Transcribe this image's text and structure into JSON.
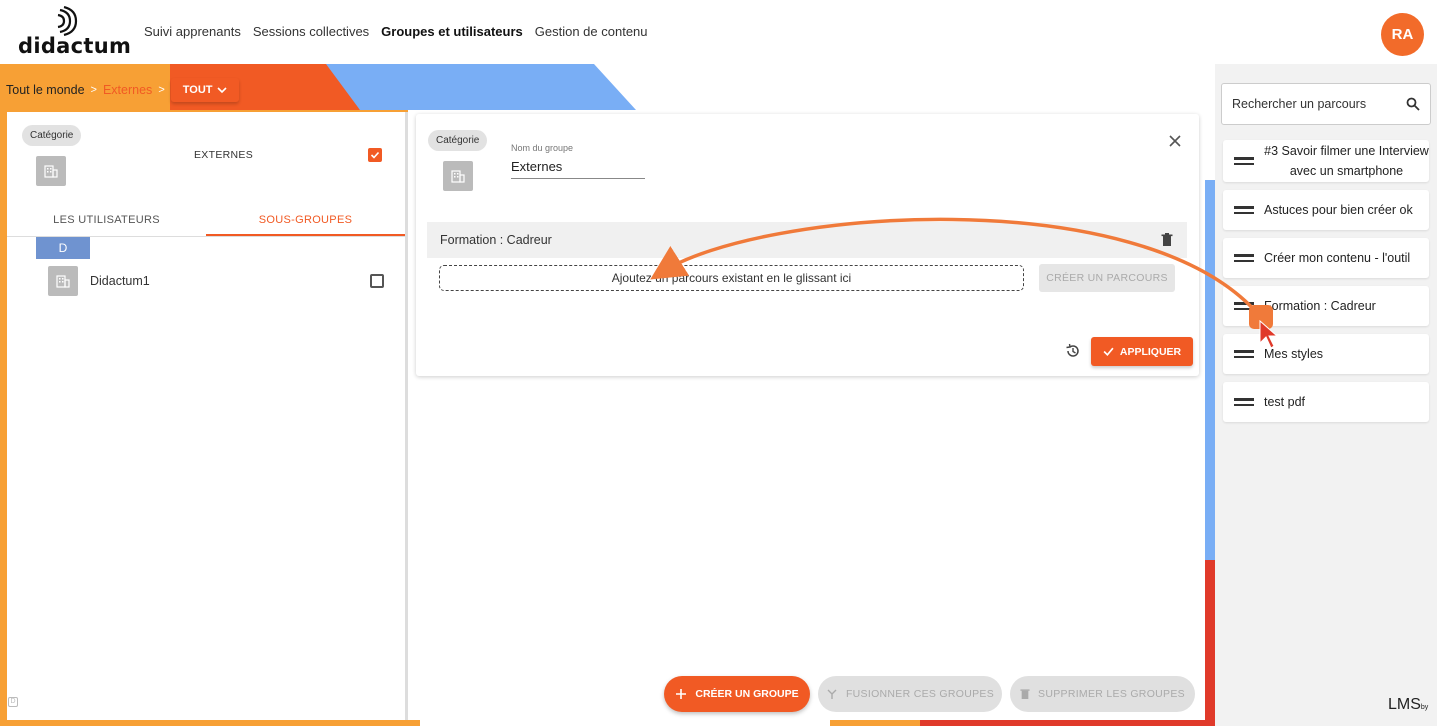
{
  "app": {
    "logo_text": "didactum",
    "avatar_initials": "RA",
    "footer_brand": "LMS",
    "footer_brand_suffix": "by"
  },
  "nav": {
    "items": [
      {
        "label": "Suivi apprenants",
        "active": false
      },
      {
        "label": "Sessions collectives",
        "active": false
      },
      {
        "label": "Groupes et utilisateurs",
        "active": true
      },
      {
        "label": "Gestion de contenu",
        "active": false
      }
    ]
  },
  "breadcrumb": {
    "root": "Tout le monde",
    "separator": ">",
    "current": "Externes",
    "filter_button": "TOUT"
  },
  "left_panel": {
    "chip": "Catégorie",
    "group_name": "EXTERNES",
    "group_checked": true,
    "tabs": [
      {
        "label": "LES UTILISATEURS",
        "active": false
      },
      {
        "label": "SOUS-GROUPES",
        "active": true
      }
    ],
    "letter_header": "D",
    "subgroups": [
      {
        "name": "Didactum1",
        "checked": false
      }
    ]
  },
  "group_editor": {
    "chip": "Catégorie",
    "name_label": "Nom du groupe",
    "name_value": "Externes",
    "section_title": "Formation : Cadreur",
    "drop_zone_text": "Ajoutez un parcours existant en le glissant ici",
    "create_course_button": "CRÉER UN PARCOURS",
    "apply_button": "APPLIQUER"
  },
  "actions": {
    "create_group": "CRÉER UN GROUPE",
    "merge_groups": "FUSIONNER CES GROUPES",
    "delete_groups": "SUPPRIMER LES GROUPES"
  },
  "right_panel": {
    "search_placeholder": "Rechercher un parcours",
    "courses": [
      "#3 Savoir filmer une Interview avec un smartphone",
      "Astuces pour bien créer ok",
      "Créer mon contenu - l'outil",
      "Formation : Cadreur",
      "Mes styles",
      "test pdf"
    ]
  },
  "colors": {
    "accent": "#f15a24",
    "accent_light": "#f7a035",
    "blue": "#79aef5",
    "letter_header": "#6f93d0",
    "red": "#e03a2a"
  }
}
